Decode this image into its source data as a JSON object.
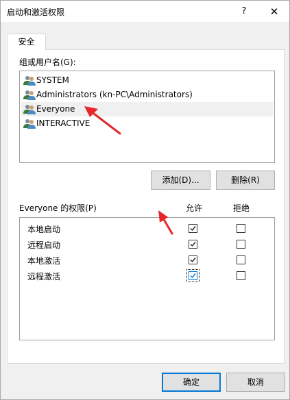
{
  "window": {
    "title": "启动和激活权限",
    "help_glyph": "?",
    "close_glyph": "✕"
  },
  "tabs": [
    {
      "label": "安全",
      "selected": true
    }
  ],
  "users_section": {
    "label": "组或用户名(G):",
    "items": [
      {
        "name": "SYSTEM",
        "selected": false
      },
      {
        "name": "Administrators (kn-PC\\Administrators)",
        "selected": false
      },
      {
        "name": "Everyone",
        "selected": true
      },
      {
        "name": "INTERACTIVE",
        "selected": false
      }
    ]
  },
  "buttons": {
    "add": "添加(D)...",
    "remove": "删除(R)",
    "ok": "确定",
    "cancel": "取消"
  },
  "permissions_section": {
    "label": "Everyone 的权限(P)",
    "allow_header": "允许",
    "deny_header": "拒绝",
    "rows": [
      {
        "name": "本地启动",
        "allow": true,
        "deny": false
      },
      {
        "name": "远程启动",
        "allow": true,
        "deny": false
      },
      {
        "name": "本地激活",
        "allow": true,
        "deny": false
      },
      {
        "name": "远程激活",
        "allow": true,
        "deny": false,
        "focused": true
      }
    ]
  },
  "colors": {
    "accent": "#0078d7",
    "annotation": "#e8262a"
  },
  "icons": {
    "user_group": "users-group-icon",
    "check": "checkmark-icon"
  }
}
